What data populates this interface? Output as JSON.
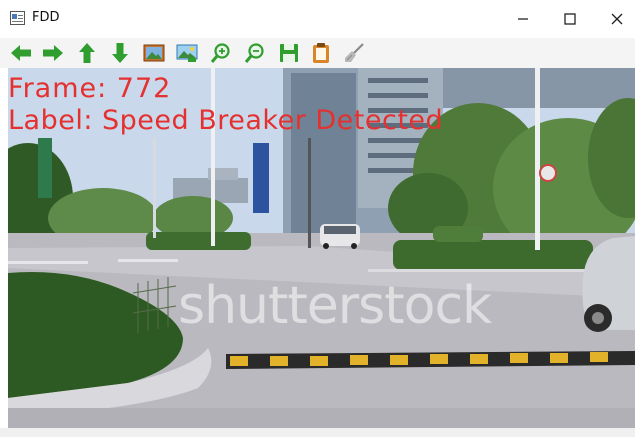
{
  "window": {
    "title": "FDD",
    "minimize_label": "–",
    "maximize_label": "☐",
    "close_label": "✕"
  },
  "toolbar": {
    "buttons": [
      {
        "icon": "arrow-left-icon"
      },
      {
        "icon": "arrow-right-icon"
      },
      {
        "icon": "arrow-up-icon"
      },
      {
        "icon": "arrow-down-icon"
      },
      {
        "icon": "image-icon"
      },
      {
        "icon": "image-select-icon"
      },
      {
        "icon": "zoom-in-icon"
      },
      {
        "icon": "zoom-out-icon"
      },
      {
        "icon": "save-icon"
      },
      {
        "icon": "clipboard-icon"
      },
      {
        "icon": "brush-icon"
      }
    ]
  },
  "video": {
    "frame_text": "Frame: 772",
    "label_text": "Label: Speed Breaker Detected",
    "watermark": "shutterstock"
  },
  "colors": {
    "overlay_text": "#e53030",
    "toolbar_icon_green": "#2f9e2f",
    "sky": "#c9d8ea",
    "road": "#b9b9bf",
    "speed_breaker_yellow": "#e2b22a"
  }
}
